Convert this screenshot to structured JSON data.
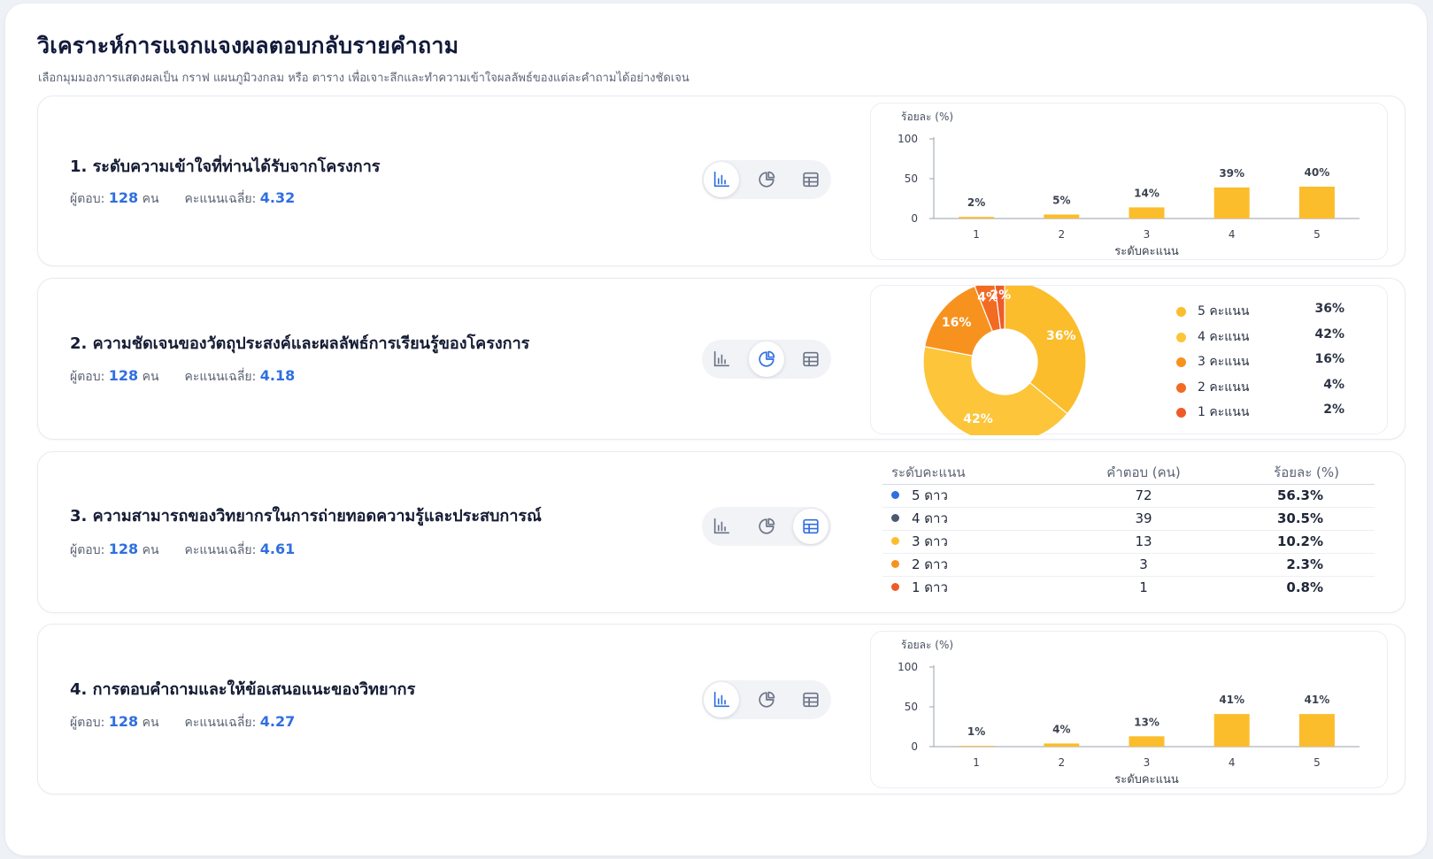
{
  "page": {
    "title": "วิเคราะห์การแจกแจงผลตอบกลับรายคำถาม",
    "subtitle": "เลือกมุมมองการแสดงผลเป็น กราฟ แผนภูมิวงกลม หรือ ตาราง เพื่อเจาะลึกและทำความเข้าใจผลลัพธ์ของแต่ละคำถามได้อย่างชัดเจน"
  },
  "labels": {
    "respondents": "ผู้ตอบ:",
    "unit": "คน",
    "avg": "คะแนนเฉลี่ย:"
  },
  "colors": {
    "accent": "#2f6fe0",
    "bar": "#fbbd2b",
    "pie": [
      "#fbbd2b",
      "#fcc53a",
      "#f8921e",
      "#f26b22",
      "#ef5a29"
    ],
    "table_dots": [
      "#2f6fe0",
      "#4d5872",
      "#fbbd2b",
      "#f8921e",
      "#ef5a29"
    ]
  },
  "questions": [
    {
      "title": "1. ระดับความเข้าใจที่ท่านได้รับจากโครงการ",
      "respondents": "128",
      "avg": "4.32",
      "view": "bar",
      "chart_data": {
        "type": "bar",
        "categories": [
          "1",
          "2",
          "3",
          "4",
          "5"
        ],
        "values": [
          2,
          5,
          14,
          39,
          40
        ],
        "value_labels": [
          "2%",
          "5%",
          "14%",
          "39%",
          "40%"
        ],
        "ylabel": "ร้อยละ (%)",
        "xlabel": "ระดับคะแนน",
        "yticks": [
          "0",
          "50",
          "100"
        ],
        "ylim": [
          0,
          100
        ]
      }
    },
    {
      "title": "2. ความชัดเจนของวัตถุประสงค์และผลลัพธ์การเรียนรู้ของโครงการ",
      "respondents": "128",
      "avg": "4.18",
      "view": "pie",
      "chart_data": {
        "type": "pie",
        "labels": [
          "5 คะแนน",
          "4 คะแนน",
          "3 คะแนน",
          "2 คะแนน",
          "1 คะแนน"
        ],
        "values": [
          36,
          42,
          16,
          4,
          2
        ],
        "value_labels": [
          "36%",
          "42%",
          "16%",
          "4%",
          "2%"
        ],
        "legend": "right"
      }
    },
    {
      "title": "3. ความสามารถของวิทยากรในการถ่ายทอดความรู้และประสบการณ์",
      "respondents": "128",
      "avg": "4.61",
      "view": "table",
      "chart_data": {
        "type": "table",
        "columns": [
          "ระดับคะแนน",
          "คำตอบ (คน)",
          "ร้อยละ (%)"
        ],
        "rows": [
          [
            "5 ดาว",
            "72",
            "56.3%"
          ],
          [
            "4 ดาว",
            "39",
            "30.5%"
          ],
          [
            "3 ดาว",
            "13",
            "10.2%"
          ],
          [
            "2 ดาว",
            "3",
            "2.3%"
          ],
          [
            "1 ดาว",
            "1",
            "0.8%"
          ]
        ]
      }
    },
    {
      "title": "4. การตอบคำถามและให้ข้อเสนอแนะของวิทยากร",
      "respondents": "128",
      "avg": "4.27",
      "view": "bar",
      "chart_data": {
        "type": "bar",
        "categories": [
          "1",
          "2",
          "3",
          "4",
          "5"
        ],
        "values": [
          1,
          4,
          13,
          41,
          41
        ],
        "value_labels": [
          "1%",
          "4%",
          "13%",
          "41%",
          "41%"
        ],
        "ylabel": "ร้อยละ (%)",
        "xlabel": "ระดับคะแนน",
        "yticks": [
          "0",
          "50",
          "100"
        ],
        "ylim": [
          0,
          100
        ]
      }
    }
  ],
  "icons": {
    "bar": "bar-chart-icon",
    "pie": "pie-chart-icon",
    "table": "table-icon"
  }
}
